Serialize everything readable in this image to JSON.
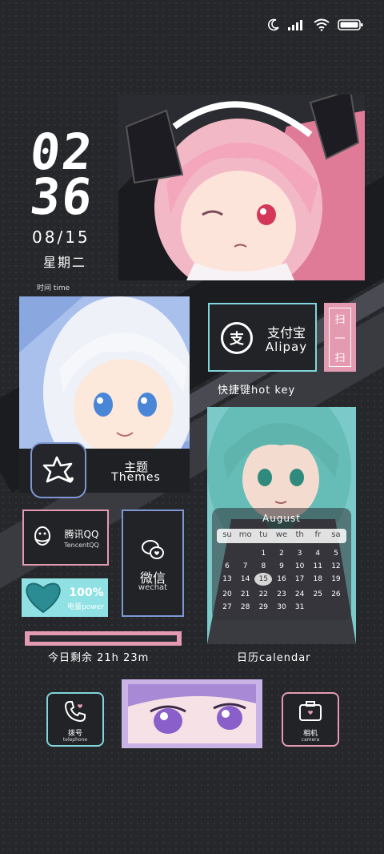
{
  "status_bar": {
    "icons": [
      "moon-icon",
      "signal-icon",
      "wifi-icon",
      "battery-icon"
    ]
  },
  "clock": {
    "hour": "02",
    "minute": "36",
    "date": "08/15",
    "weekday": "星期二",
    "label": "时间 time"
  },
  "themes": {
    "title_cn": "主题",
    "title_en": "Themes"
  },
  "alipay": {
    "title_cn": "支付宝",
    "title_en": "Alipay",
    "icon_char": "支",
    "scan_chars": [
      "扫",
      "一",
      "扫"
    ]
  },
  "hotkey": {
    "label": "快捷键hot key"
  },
  "qq": {
    "title_cn": "腾讯QQ",
    "title_en": "TencentQQ"
  },
  "wechat": {
    "title_cn": "微信",
    "title_en": "wechat"
  },
  "battery": {
    "percent_text": "100%",
    "label": "电量power",
    "level": 1.0
  },
  "day_remaining": {
    "text": "今日剩余 21h 23m",
    "fraction": 0.98
  },
  "calendar": {
    "month": "August",
    "weekdays": [
      "su",
      "mo",
      "tu",
      "we",
      "th",
      "fr",
      "sa"
    ],
    "weeks": [
      [
        "",
        "",
        "",
        "1",
        "2",
        "3",
        "4",
        "5"
      ],
      [
        "6",
        "7",
        "8",
        "9",
        "10",
        "11",
        "12"
      ],
      [
        "13",
        "14",
        "15",
        "16",
        "17",
        "18",
        "19"
      ],
      [
        "20",
        "21",
        "22",
        "23",
        "24",
        "25",
        "26"
      ],
      [
        "27",
        "28",
        "29",
        "30",
        "31",
        "",
        ""
      ]
    ],
    "today": "15",
    "label": "日历calendar"
  },
  "dock": {
    "phone": {
      "title_cn": "拨号",
      "title_en": "telephone"
    },
    "camera": {
      "title_cn": "相机",
      "title_en": "camera"
    }
  },
  "colors": {
    "pink": "#e49ab0",
    "cyan": "#7fd6db",
    "blue": "#7e97d4",
    "lavender": "#c9b3e6",
    "bg": "#26272b"
  }
}
